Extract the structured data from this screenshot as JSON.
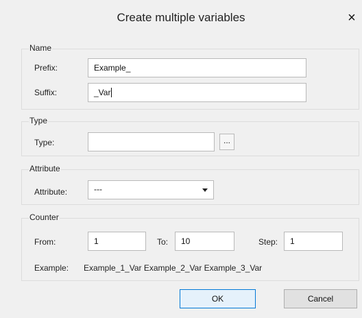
{
  "dialog": {
    "title": "Create multiple variables",
    "close_glyph": "×"
  },
  "name_group": {
    "label": "Name",
    "prefix_label": "Prefix:",
    "prefix_value": "Example_",
    "suffix_label": "Suffix:",
    "suffix_value": "_Var"
  },
  "type_group": {
    "label": "Type",
    "type_label": "Type:",
    "type_value": "",
    "browse_label": "..."
  },
  "attribute_group": {
    "label": "Attribute",
    "attribute_label": "Attribute:",
    "attribute_value": "---"
  },
  "counter_group": {
    "label": "Counter",
    "from_label": "From:",
    "from_value": "1",
    "to_label": "To:",
    "to_value": "10",
    "step_label": "Step:",
    "step_value": "1",
    "example_label": "Example:",
    "example_value": "Example_1_Var Example_2_Var Example_3_Var"
  },
  "buttons": {
    "ok_label": "OK",
    "cancel_label": "Cancel"
  },
  "icons": {
    "close": "close-icon",
    "dropdown": "chevron-down-icon"
  }
}
